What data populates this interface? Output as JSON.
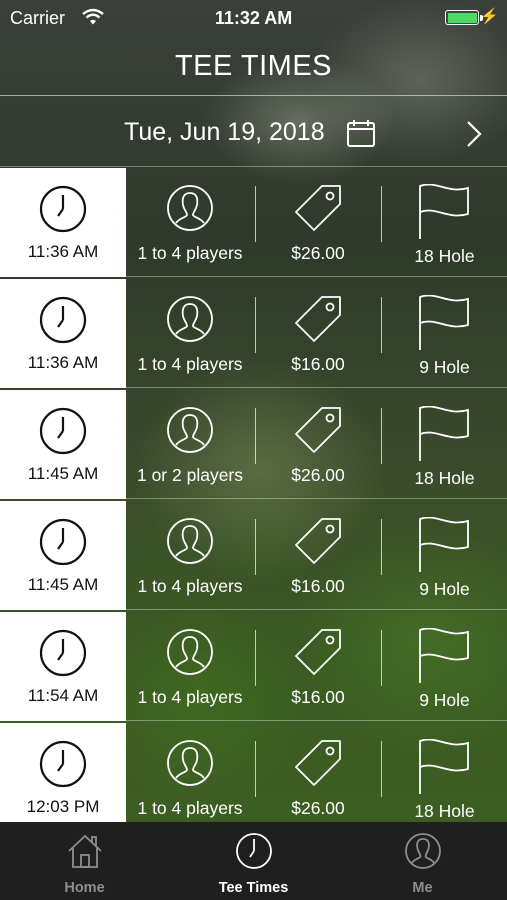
{
  "status_bar": {
    "carrier": "Carrier",
    "time": "11:32 AM"
  },
  "header": {
    "title": "TEE TIMES"
  },
  "date_bar": {
    "date": "Tue, Jun 19, 2018"
  },
  "tee_times": [
    {
      "time": "11:36 AM",
      "players": "1 to 4 players",
      "price": "$26.00",
      "holes": "18 Hole"
    },
    {
      "time": "11:36 AM",
      "players": "1 to 4 players",
      "price": "$16.00",
      "holes": "9 Hole"
    },
    {
      "time": "11:45 AM",
      "players": "1 or 2 players",
      "price": "$26.00",
      "holes": "18 Hole"
    },
    {
      "time": "11:45 AM",
      "players": "1 to 4 players",
      "price": "$16.00",
      "holes": "9 Hole"
    },
    {
      "time": "11:54 AM",
      "players": "1 to 4 players",
      "price": "$16.00",
      "holes": "9 Hole"
    },
    {
      "time": "12:03 PM",
      "players": "1 to 4 players",
      "price": "$26.00",
      "holes": "18 Hole"
    }
  ],
  "tab_bar": {
    "tabs": [
      {
        "label": "Home",
        "icon": "home-icon",
        "selected": false
      },
      {
        "label": "Tee Times",
        "icon": "clock-icon",
        "selected": true
      },
      {
        "label": "Me",
        "icon": "person-icon",
        "selected": false
      }
    ]
  },
  "colors": {
    "battery": "#4cd964",
    "tab_bar": "#1f1f1f",
    "inactive_tab": "#8e8e8e"
  }
}
